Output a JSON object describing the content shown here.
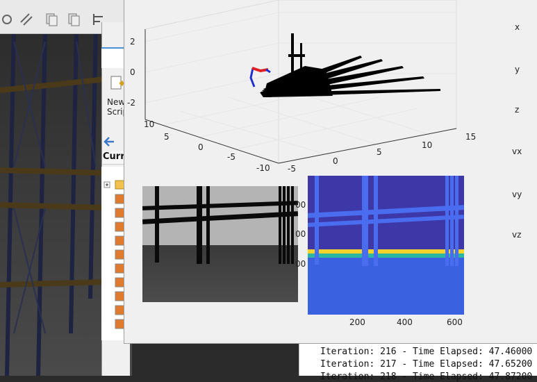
{
  "editor": {
    "new_script_label": "New\nScrip",
    "current_folder_header": "Curr"
  },
  "figure": {
    "state_labels": [
      "x",
      "y",
      "z",
      "vx",
      "vy",
      "vz"
    ],
    "plot3d": {
      "z_ticks": [
        "2",
        "0",
        "-2"
      ],
      "x_ticks": [
        "10",
        "5",
        "0",
        "-5",
        "-10"
      ],
      "y_ticks": [
        "-5",
        "0",
        "5",
        "10",
        "15"
      ]
    },
    "depth_image": {
      "x_ticks": [
        "200",
        "400",
        "600"
      ],
      "y_ticks_partial": [
        "00",
        "00",
        "00"
      ]
    }
  },
  "command_window": {
    "lines": [
      "Iteration: 216 - Time Elapsed: 47.46000",
      "Iteration: 217 - Time Elapsed: 47.65200",
      "Iteration: 218 - Time Elapsed: 47.87200"
    ]
  },
  "colors": {
    "depth_far": "#3e37a8",
    "depth_ground_top": "#f5d32b",
    "depth_ground": "#3a62e0",
    "structure": "#3f5ee8",
    "trajectory_red": "#e02020",
    "trajectory_blue": "#2030d0"
  }
}
